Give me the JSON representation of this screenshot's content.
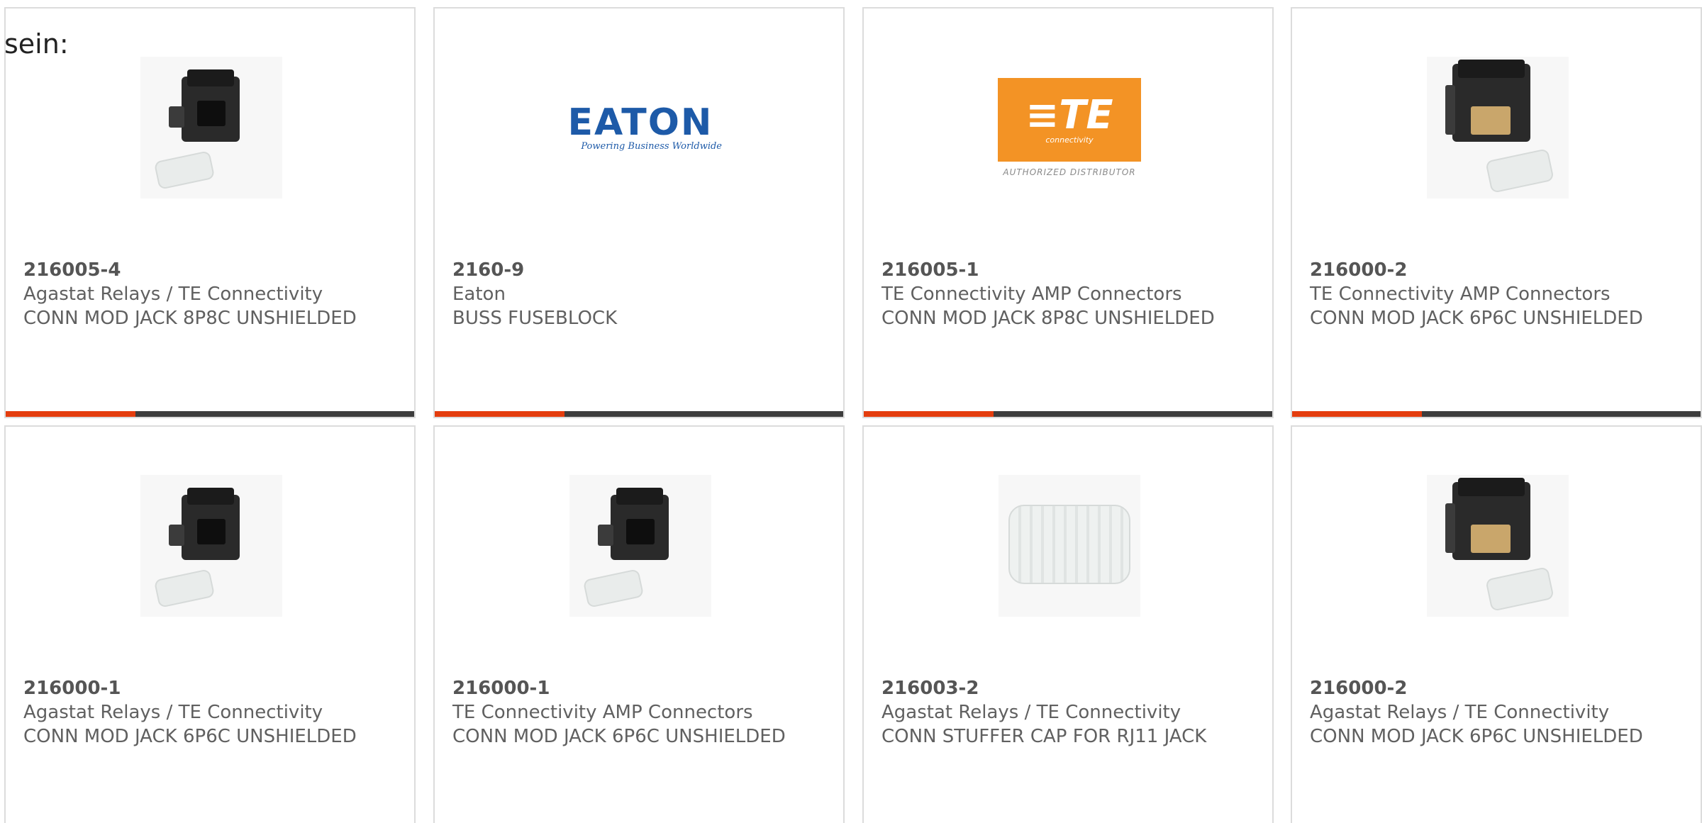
{
  "intro": "sein:",
  "colors": {
    "accent": "#e43d0e",
    "bar": "#3d3d3d",
    "eaton_blue": "#1d5aa8",
    "te_orange": "#f39325"
  },
  "logos": {
    "eaton": {
      "word": "EATON",
      "tagline": "Powering Business Worldwide"
    },
    "te": {
      "mark": "≡TE",
      "sub": "connectivity",
      "authorized": "AUTHORIZED DISTRIBUTOR"
    }
  },
  "products": [
    {
      "part_number": "216005-4",
      "manufacturer": "Agastat Relays / TE Connectivity",
      "description": "CONN MOD JACK 8P8C UNSHIELDED",
      "image": "modular-jack-icon"
    },
    {
      "part_number": "2160-9",
      "manufacturer": "Eaton",
      "description": "BUSS FUSEBLOCK",
      "image": "eaton-logo"
    },
    {
      "part_number": "216005-1",
      "manufacturer": "TE Connectivity AMP Connectors",
      "description": "CONN MOD JACK 8P8C UNSHIELDED",
      "image": "te-logo"
    },
    {
      "part_number": "216000-2",
      "manufacturer": "TE Connectivity AMP Connectors",
      "description": "CONN MOD JACK 6P6C UNSHIELDED",
      "image": "modular-jack-pins-icon"
    },
    {
      "part_number": "216000-1",
      "manufacturer": "Agastat Relays / TE Connectivity",
      "description": "CONN MOD JACK 6P6C UNSHIELDED",
      "image": "modular-jack-icon"
    },
    {
      "part_number": "216000-1",
      "manufacturer": "TE Connectivity AMP Connectors",
      "description": "CONN MOD JACK 6P6C UNSHIELDED",
      "image": "modular-jack-icon"
    },
    {
      "part_number": "216003-2",
      "manufacturer": "Agastat Relays / TE Connectivity",
      "description": "CONN STUFFER CAP FOR RJ11 JACK",
      "image": "stuffer-cap-icon"
    },
    {
      "part_number": "216000-2",
      "manufacturer": "Agastat Relays / TE Connectivity",
      "description": "CONN MOD JACK 6P6C UNSHIELDED",
      "image": "modular-jack-pins-icon"
    }
  ]
}
